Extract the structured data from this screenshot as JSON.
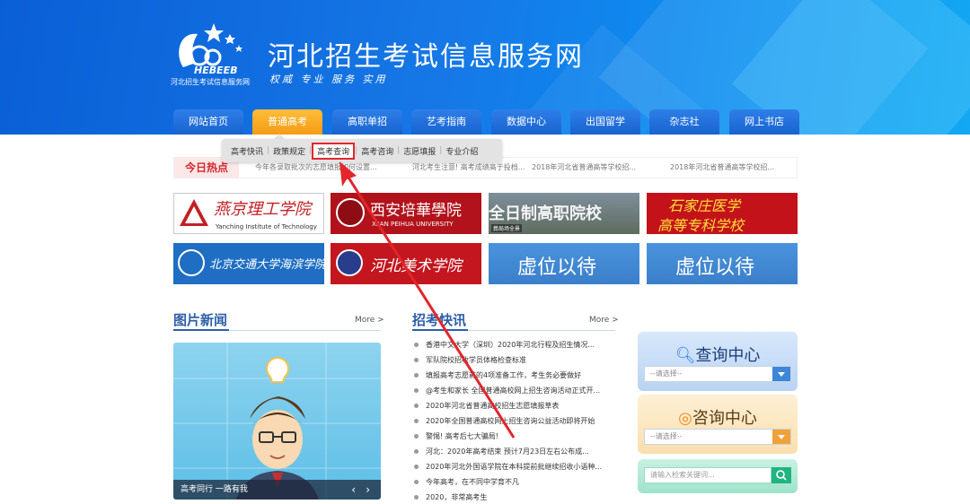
{
  "header": {
    "logo_text": "HEBEEB",
    "logo_subtitle": "河北招生考试信息服务网",
    "title": "河北招生考试信息服务网",
    "slogan": "权威 专业 服务 实用"
  },
  "nav": {
    "items": [
      "网站首页",
      "普通高考",
      "高职单招",
      "艺考指南",
      "数据中心",
      "出国留学",
      "杂志社",
      "网上书店"
    ],
    "active_index": 1
  },
  "submenu": {
    "items": [
      "高考快讯",
      "政策规定",
      "高考查询",
      "高考咨询",
      "志愿填报",
      "专业介绍"
    ],
    "highlighted": "高考查询"
  },
  "hot": {
    "label": "今日热点",
    "items": [
      "今年各录取批次的志愿填报如何设置...",
      "河北考生注意! 高考成绩高于投档...",
      "2018年河北省普通高等学校招...",
      "2018年河北省普通高等学校招..."
    ]
  },
  "banners": {
    "b1": {
      "main": "燕京理工学院",
      "sub": "Yanching Institute of Technology"
    },
    "b2": {
      "main": "西安培華學院",
      "sub": "XI'AN PEIHUA UNIVERSITY"
    },
    "b3": {
      "main": "全日制高职院校",
      "tag": "葬局场全景"
    },
    "b4": {
      "line1": "石家庄医学",
      "line2": "高等专科学校"
    },
    "b5": {
      "main": "北京交通大学海滨学院"
    },
    "b6": {
      "main": "河北美术学院"
    },
    "b7": {
      "main": "虚位以待"
    },
    "b8": {
      "main": "虚位以待"
    }
  },
  "photo_news": {
    "title": "图片新闻",
    "more": "More >",
    "caption": "高考同行 一路有我"
  },
  "news": {
    "title": "招考快讯",
    "more": "More >",
    "items": [
      "香港中文大学（深圳）2020年河北行程及招生情况...",
      "军队院校招收学员体格检查标准",
      "填报高考志愿前的4项准备工作，考生务必要做好",
      "@考生和家长 全国普通高校网上招生咨询活动正式开...",
      "2020年河北省普通高校招生志愿填报草表",
      "2020年全国普通高校网上招生咨询公益活动即将开始",
      "警惕! 高考后七大骗局!",
      "河北：2020年高考结束 预计7月23日左右公布成...",
      "2020年河北外国语学院在本科提前批继续招收小语种...",
      "今年高考，在不同中学育不凡",
      "2020，非常高考生"
    ]
  },
  "query_center": {
    "title": "查询中心",
    "select": "--请选择--"
  },
  "consult_center": {
    "title": "咨询中心",
    "select": "--请选择--"
  },
  "search": {
    "placeholder": "请输入检索关键词..."
  },
  "colors": {
    "primary_blue": "#1863d0",
    "active_orange": "#f59b15",
    "highlight_red": "#e3262b",
    "section_blue": "#2d5fa8"
  }
}
